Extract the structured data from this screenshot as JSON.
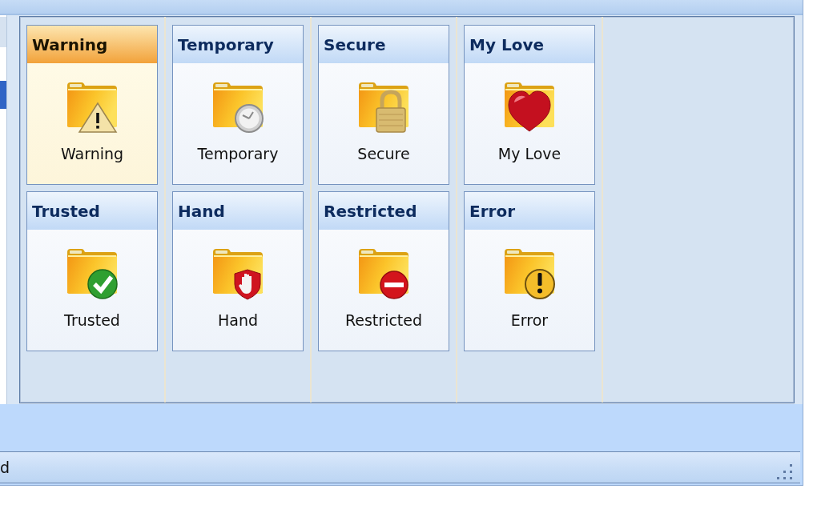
{
  "list_pane": {
    "rows": [
      {
        "selected": true
      }
    ]
  },
  "cards": [
    {
      "title": "Warning",
      "kind": "warning",
      "label": "Warning",
      "selected": true
    },
    {
      "title": "Temporary",
      "kind": "clock",
      "label": "Temporary",
      "selected": false
    },
    {
      "title": "Secure",
      "kind": "lock",
      "label": "Secure",
      "selected": false
    },
    {
      "title": "My Love",
      "kind": "heart",
      "label": "My Love",
      "selected": false
    },
    {
      "title": "Trusted",
      "kind": "check",
      "label": "Trusted",
      "selected": false
    },
    {
      "title": "Hand",
      "kind": "hand",
      "label": "Hand",
      "selected": false
    },
    {
      "title": "Restricted",
      "kind": "no-entry",
      "label": "Restricted",
      "selected": false
    },
    {
      "title": "Error",
      "kind": "exclamation",
      "label": "Error",
      "selected": false
    }
  ],
  "status_bar": {
    "text": "d"
  }
}
